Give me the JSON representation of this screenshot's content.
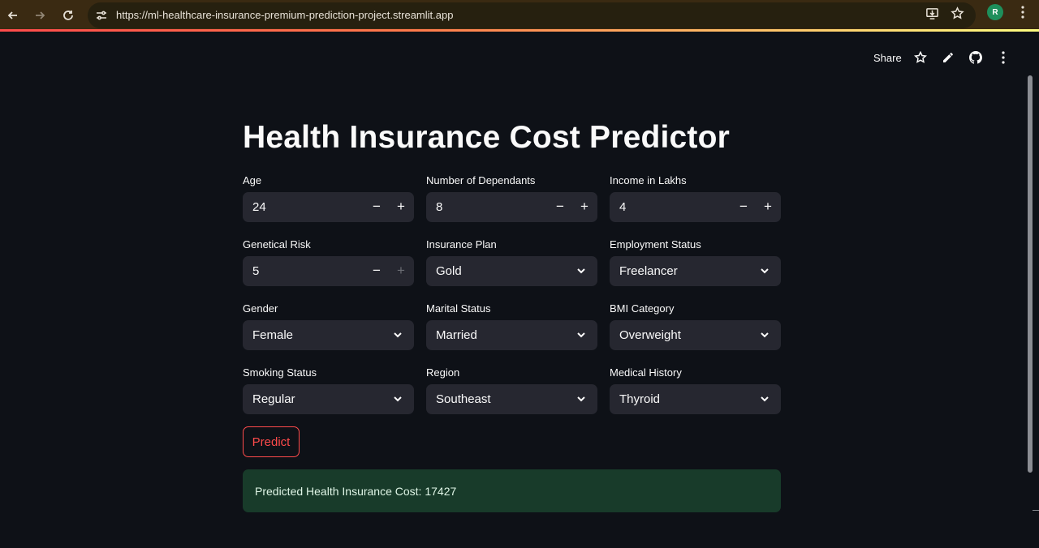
{
  "browser": {
    "url": "https://ml-healthcare-insurance-premium-prediction-project.streamlit.app",
    "profile_initial": "R",
    "icons": [
      "back-icon",
      "forward-icon",
      "reload-icon",
      "site-settings-icon",
      "install-icon",
      "bookmark-star-icon",
      "more-vert-icon"
    ]
  },
  "header": {
    "share_label": "Share",
    "icons": [
      "star-icon",
      "edit-icon",
      "github-icon",
      "menu-icon"
    ]
  },
  "main": {
    "title": "Health Insurance Cost Predictor",
    "fields": {
      "age": {
        "label": "Age",
        "value": "24"
      },
      "dependants": {
        "label": "Number of Dependants",
        "value": "8"
      },
      "income": {
        "label": "Income in Lakhs",
        "value": "4"
      },
      "genetical_risk": {
        "label": "Genetical Risk",
        "value": "5"
      },
      "insurance_plan": {
        "label": "Insurance Plan",
        "value": "Gold"
      },
      "employment_status": {
        "label": "Employment Status",
        "value": "Freelancer"
      },
      "gender": {
        "label": "Gender",
        "value": "Female"
      },
      "marital_status": {
        "label": "Marital Status",
        "value": "Married"
      },
      "bmi_category": {
        "label": "BMI Category",
        "value": "Overweight"
      },
      "smoking_status": {
        "label": "Smoking Status",
        "value": "Regular"
      },
      "region": {
        "label": "Region",
        "value": "Southeast"
      },
      "medical_history": {
        "label": "Medical History",
        "value": "Thyroid"
      }
    },
    "stepper_minus": "−",
    "stepper_plus": "+",
    "predict_label": "Predict",
    "result_text": "Predicted Health Insurance Cost: 17427"
  },
  "colors": {
    "background": "#0e1117",
    "widget": "#262730",
    "accent": "#ff4b4b",
    "success_bg": "#183b2a"
  }
}
